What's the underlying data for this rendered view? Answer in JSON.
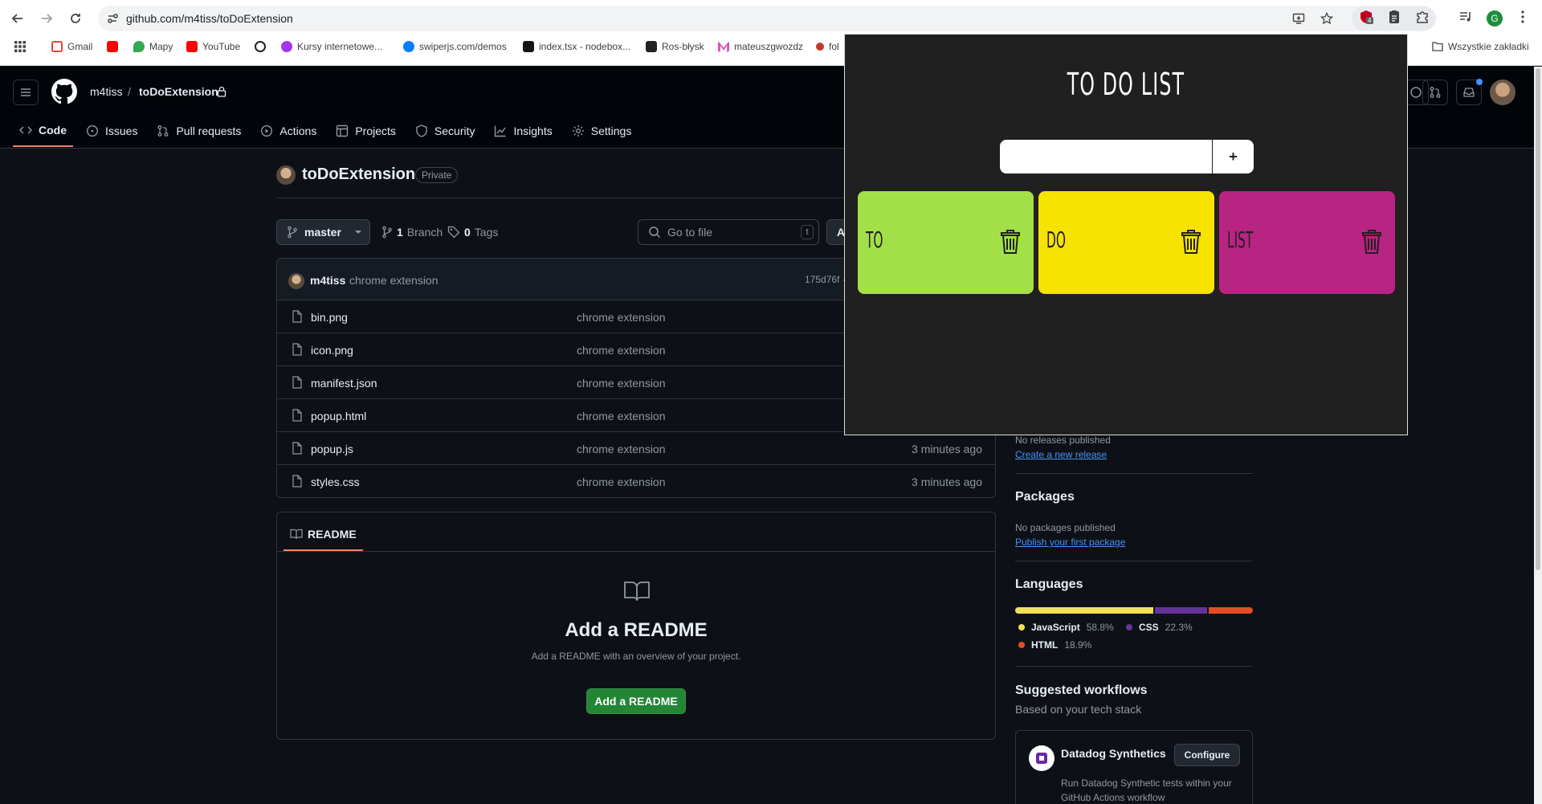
{
  "browser": {
    "url": "github.com/m4tiss/toDoExtension",
    "extension_badge": "4",
    "profile_initial": "G",
    "bookmarks": [
      {
        "label": "Gmail",
        "icon": "gmail-icon",
        "color": "#ea4335"
      },
      {
        "label": "",
        "icon": "youtube-icon",
        "color": "#ff0000"
      },
      {
        "label": "Mapy",
        "icon": "maps-icon",
        "color": "#34a853"
      },
      {
        "label": "YouTube",
        "icon": "youtube-icon",
        "color": "#ff0000"
      },
      {
        "label": "",
        "icon": "openai-icon",
        "color": "#202124"
      },
      {
        "label": "Kursy internetowe...",
        "icon": "udemy-icon",
        "color": "#a435f0"
      },
      {
        "label": "swiperjs.com/demos",
        "icon": "swiper-icon",
        "color": "#0080ff"
      },
      {
        "label": "index.tsx - nodebox...",
        "icon": "codesandbox-icon",
        "color": "#151515"
      },
      {
        "label": "Ros-błysk",
        "icon": "rosblysk-icon",
        "color": "#222222"
      },
      {
        "label": "mateuszgwozdz",
        "icon": "m-icon",
        "color": "#d94fb3"
      },
      {
        "label": "fol",
        "icon": "folder-icon",
        "color": "#c0392b"
      }
    ],
    "all_bookmarks": "Wszystkie zakładki"
  },
  "github": {
    "owner": "m4tiss",
    "repo": "toDoExtension",
    "tabs": [
      {
        "label": "Code",
        "icon": "code-icon",
        "active": true
      },
      {
        "label": "Issues",
        "icon": "issue-icon"
      },
      {
        "label": "Pull requests",
        "icon": "pull-request-icon"
      },
      {
        "label": "Actions",
        "icon": "play-icon"
      },
      {
        "label": "Projects",
        "icon": "table-icon"
      },
      {
        "label": "Security",
        "icon": "shield-icon"
      },
      {
        "label": "Insights",
        "icon": "graph-icon"
      },
      {
        "label": "Settings",
        "icon": "gear-icon"
      }
    ],
    "visibility": "Private",
    "branch": "master",
    "branches_count": "1",
    "branches_label": "Branch",
    "tags_count": "0",
    "tags_label": "Tags",
    "goto_placeholder": "Go to file",
    "goto_shortcut": "t",
    "add_file_stub": "A",
    "last_commit": {
      "author": "m4tiss",
      "message": "chrome extension",
      "hash": "175d76f ·"
    },
    "files": [
      {
        "name": "bin.png",
        "message": "chrome extension",
        "time": ""
      },
      {
        "name": "icon.png",
        "message": "chrome extension",
        "time": ""
      },
      {
        "name": "manifest.json",
        "message": "chrome extension",
        "time": ""
      },
      {
        "name": "popup.html",
        "message": "chrome extension",
        "time": ""
      },
      {
        "name": "popup.js",
        "message": "chrome extension",
        "time": "3 minutes ago"
      },
      {
        "name": "styles.css",
        "message": "chrome extension",
        "time": "3 minutes ago"
      }
    ],
    "readme": {
      "tab": "README",
      "heading": "Add a README",
      "sub": "Add a README with an overview of your project.",
      "button": "Add a README"
    },
    "sidebar": {
      "releases_text": "No releases published",
      "releases_link": "Create a new release",
      "packages_heading": "Packages",
      "packages_text": "No packages published",
      "packages_link": "Publish your first package",
      "languages_heading": "Languages",
      "languages": [
        {
          "name": "JavaScript",
          "percent": "58.8%",
          "value": 58.8,
          "color": "#f1e05a"
        },
        {
          "name": "CSS",
          "percent": "22.3%",
          "value": 22.3,
          "color": "#663399"
        },
        {
          "name": "HTML",
          "percent": "18.9%",
          "value": 18.9,
          "color": "#e34c26"
        }
      ],
      "workflows_heading": "Suggested workflows",
      "workflows_sub": "Based on your tech stack",
      "workflow": {
        "name": "Datadog Synthetics",
        "button": "Configure",
        "description": "Run Datadog Synthetic tests within your GitHub Actions workflow"
      }
    }
  },
  "popup": {
    "title": "TO DO LIST",
    "input_value": "",
    "add_label": "+",
    "notes": [
      {
        "text": "TO",
        "color": "#a3e048"
      },
      {
        "text": "DO",
        "color": "#f7e200"
      },
      {
        "text": "LIST",
        "color": "#b82481"
      }
    ]
  }
}
